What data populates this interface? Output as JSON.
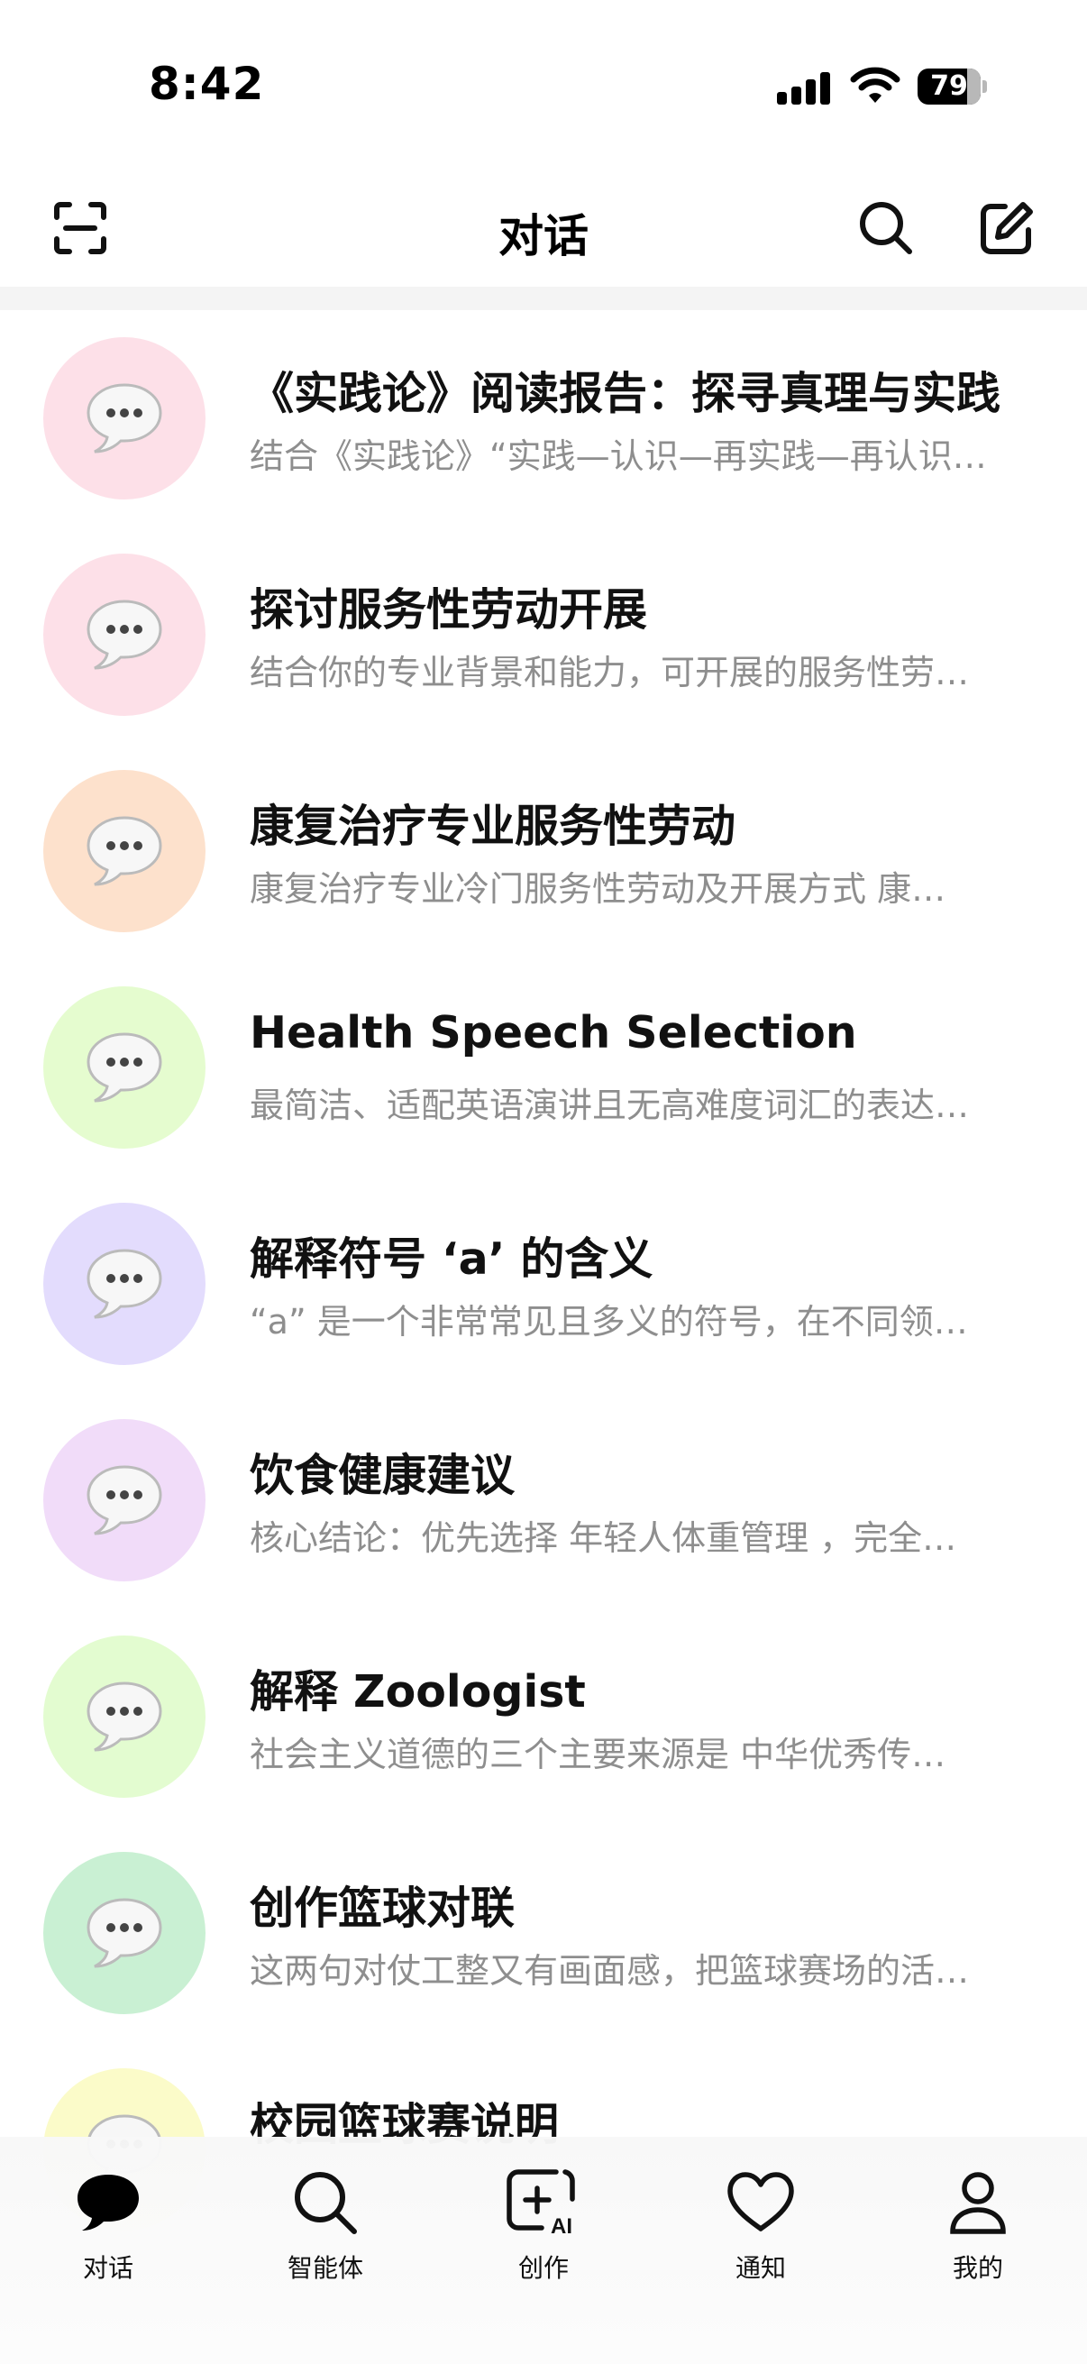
{
  "status": {
    "time": "8:42",
    "battery": "79"
  },
  "header": {
    "title": "对话"
  },
  "conversations": [
    {
      "title": "《实践论》阅读报告：探寻真理与实践",
      "preview": "结合《实践论》“实践—认识—再实践—再认识…",
      "color": "#fde0e8"
    },
    {
      "title": "探讨服务性劳动开展",
      "preview": "结合你的专业背景和能力，可开展的服务性劳…",
      "color": "#fde0e8"
    },
    {
      "title": "康复治疗专业服务性劳动",
      "preview": "康复治疗专业冷门服务性劳动及开展方式 康…",
      "color": "#fde1cc"
    },
    {
      "title": "Health Speech Selection",
      "preview": "最简洁、适配英语演讲且无高难度词汇的表达…",
      "color": "#e5fccf"
    },
    {
      "title": "解释符号 ‘a’ 的含义",
      "preview": "“a” 是一个非常常见且多义的符号，在不同领…",
      "color": "#e3dcfd"
    },
    {
      "title": "饮食健康建议",
      "preview": "核心结论：优先选择  年轻人体重管理  ，完全…",
      "color": "#f1dcf9"
    },
    {
      "title": "解释 Zoologist",
      "preview": "社会主义道德的三个主要来源是 中华优秀传…",
      "color": "#e3fcd0"
    },
    {
      "title": "创作篮球对联",
      "preview": "这两句对仗工整又有画面感，把篮球赛场的活…",
      "color": "#c9f0d3"
    },
    {
      "title": "校园篮球赛说明",
      "preview": "",
      "color": "#fbfbc9"
    }
  ],
  "tabs": [
    {
      "label": "对话",
      "icon": "chat-bubble-icon"
    },
    {
      "label": "智能体",
      "icon": "search-icon"
    },
    {
      "label": "创作",
      "icon": "create-ai-icon"
    },
    {
      "label": "通知",
      "icon": "heart-icon"
    },
    {
      "label": "我的",
      "icon": "user-icon"
    }
  ]
}
